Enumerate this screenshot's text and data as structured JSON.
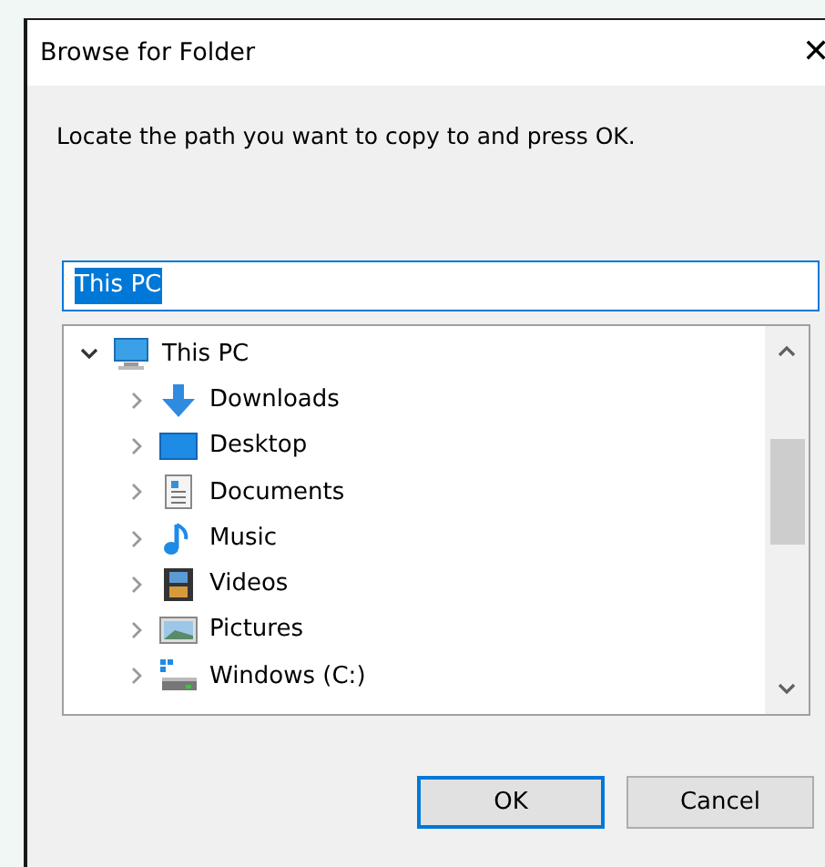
{
  "window": {
    "title": "Browse for Folder",
    "close_glyph": "✕"
  },
  "message": "Locate the path you want to copy to and press OK.",
  "path_field": {
    "value": "This PC",
    "text_selected": true
  },
  "tree": [
    {
      "label": "This PC",
      "kind": "computer",
      "expanded": true,
      "children": [
        {
          "label": "Downloads",
          "kind": "downloads",
          "expanded": false
        },
        {
          "label": "Desktop",
          "kind": "desktop",
          "expanded": false
        },
        {
          "label": "Documents",
          "kind": "documents",
          "expanded": false
        },
        {
          "label": "Music",
          "kind": "music",
          "expanded": false
        },
        {
          "label": "Videos",
          "kind": "videos",
          "expanded": false
        },
        {
          "label": "Pictures",
          "kind": "pictures",
          "expanded": false
        },
        {
          "label": "Windows (C:)",
          "kind": "drive",
          "expanded": false
        }
      ]
    }
  ],
  "buttons": [
    {
      "label": "OK",
      "default": true
    },
    {
      "label": "Cancel",
      "default": false
    }
  ]
}
